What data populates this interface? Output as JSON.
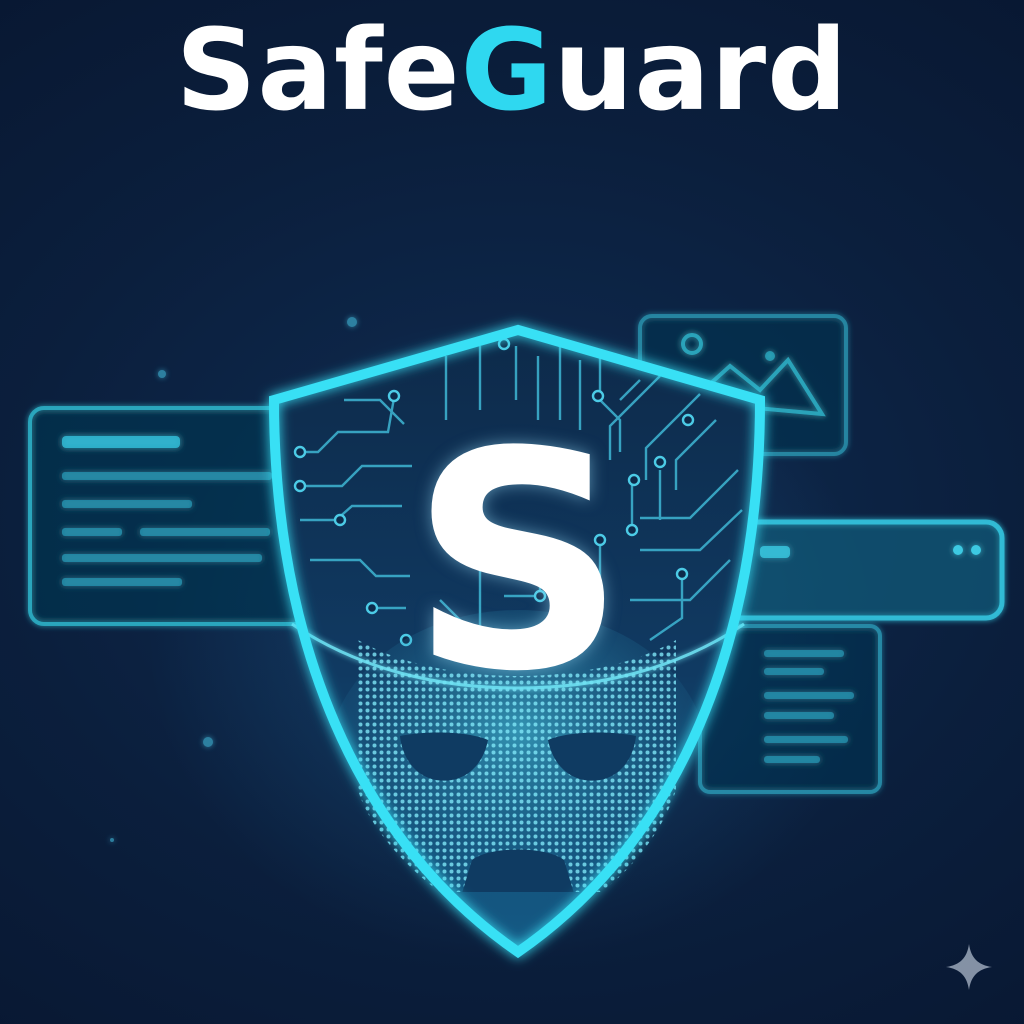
{
  "brand": {
    "name_part1": "Safe",
    "name_accent": "G",
    "name_part2": "uard",
    "shield_letter": "S"
  },
  "colors": {
    "background": "#0a1a33",
    "accent_cyan": "#2fd8f0",
    "panel_stroke": "#2fb6cc",
    "title_white": "#ffffff"
  },
  "icons": {
    "shield": "shield-icon",
    "mask": "mask-icon",
    "image_card": "image-icon",
    "sparkle": "sparkle-icon"
  }
}
